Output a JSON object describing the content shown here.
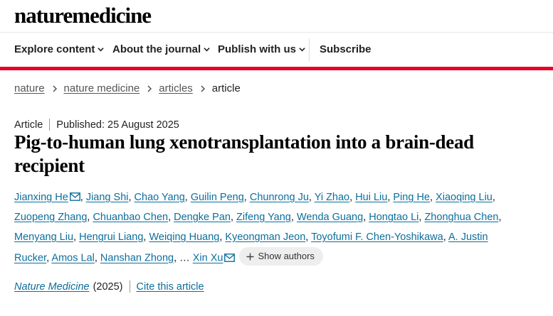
{
  "header": {
    "logo_text": "naturemedicine"
  },
  "nav": {
    "items": [
      {
        "label": "Explore content",
        "has_dropdown": true
      },
      {
        "label": "About the journal",
        "has_dropdown": true
      },
      {
        "label": "Publish with us",
        "has_dropdown": true
      },
      {
        "label": "Subscribe",
        "has_dropdown": false
      }
    ]
  },
  "breadcrumb": [
    "nature",
    "nature medicine",
    "articles",
    "article"
  ],
  "article": {
    "type": "Article",
    "published": "Published: 25 August 2025",
    "title": "Pig-to-human lung xenotransplantation into a brain-dead recipient",
    "authors": [
      "Jianxing He",
      "Jiang Shi",
      "Chao Yang",
      "Guilin Peng",
      "Chunrong Ju",
      "Yi Zhao",
      "Hui Liu",
      "Ping He",
      "Xiaoqing Liu",
      "Zuopeng Zhang",
      "Chuanbao Chen",
      "Dengke Pan",
      "Zifeng Yang",
      "Wenda Guang",
      "Hongtao Li",
      "Zhonghua Chen",
      "Menyang Liu",
      "Hengrui Liang",
      "Weiqing Huang",
      "Kyeongman Jeon",
      "Toyofumi F. Chen-Yoshikawa",
      "A. Justin Rucker",
      "Amos Lal",
      "Nanshan Zhong",
      "Xin Xu"
    ],
    "ellipsis": "…",
    "show_authors_label": "Show authors",
    "journal": "Nature Medicine",
    "year": "(2025)",
    "cite_label": "Cite this article"
  },
  "colors": {
    "accent_red": "#e60024",
    "link_blue": "#0c6e9c"
  },
  "icons": {
    "dropdown": "chevron-down-icon",
    "crumb": "chevron-right-icon",
    "mail": "mail-icon",
    "plus": "plus-icon"
  }
}
